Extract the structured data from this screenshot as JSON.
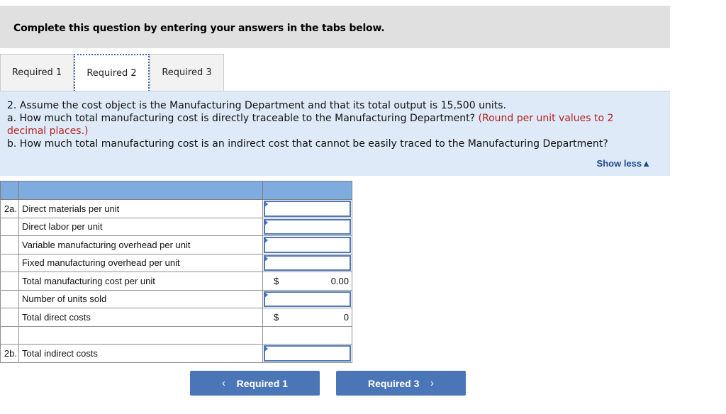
{
  "banner": {
    "text": "Complete this question by entering your answers in the tabs below."
  },
  "tabs": [
    {
      "label": "Required 1",
      "active": false
    },
    {
      "label": "Required 2",
      "active": true
    },
    {
      "label": "Required 3",
      "active": false
    }
  ],
  "prompt": {
    "line1": "2. Assume the cost object is the Manufacturing Department and that its total output is 15,500 units.",
    "line2a": "a. How much total manufacturing cost is directly traceable to the Manufacturing Department? ",
    "line2b": "(Round per unit values to 2",
    "line3": "decimal places.)",
    "line4": "b. How much total manufacturing cost is an indirect cost that cannot be easily traced to the Manufacturing Department?",
    "show_less": "Show less",
    "show_less_icon": "▲"
  },
  "table": {
    "rows": [
      {
        "label_prefix": "2a.",
        "label": "Direct materials per unit",
        "type": "input",
        "value": ""
      },
      {
        "label_prefix": "",
        "label": "Direct labor per unit",
        "type": "input",
        "value": ""
      },
      {
        "label_prefix": "",
        "label": "Variable manufacturing overhead per unit",
        "type": "input",
        "value": ""
      },
      {
        "label_prefix": "",
        "label": "Fixed manufacturing overhead per unit",
        "type": "input",
        "value": ""
      },
      {
        "label_prefix": "",
        "label": "Total manufacturing cost per unit",
        "type": "computed",
        "currency": "$",
        "value": "0.00"
      },
      {
        "label_prefix": "",
        "label": "Number of units sold",
        "type": "input",
        "value": ""
      },
      {
        "label_prefix": "",
        "label": "Total direct costs",
        "type": "computed",
        "currency": "$",
        "value": "0"
      },
      {
        "label_prefix": "",
        "label": "",
        "type": "blank",
        "value": ""
      },
      {
        "label_prefix": "2b.",
        "label": "Total indirect costs",
        "type": "input",
        "value": ""
      }
    ]
  },
  "nav": {
    "prev_label": "Required 1",
    "prev_icon": "‹",
    "next_label": "Required 3",
    "next_icon": "›"
  }
}
